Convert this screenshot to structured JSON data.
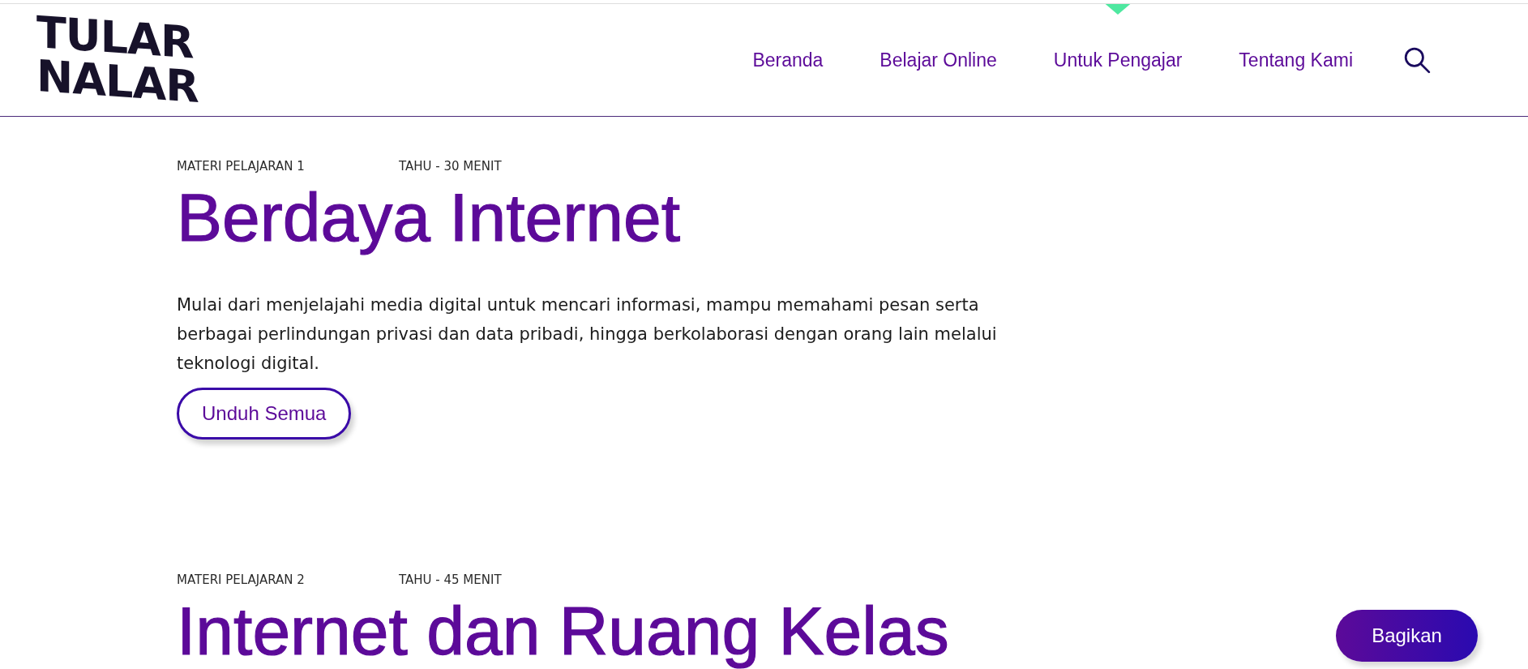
{
  "logo": {
    "lines": [
      "TULAR",
      "NALAR"
    ]
  },
  "nav": {
    "items": [
      {
        "label": "Beranda",
        "selected": false
      },
      {
        "label": "Belajar Online",
        "selected": false
      },
      {
        "label": "Untuk Pengajar",
        "selected": true
      },
      {
        "label": "Tentang Kami",
        "selected": false
      }
    ]
  },
  "lessons": [
    {
      "number": "MATERI PELAJARAN 1",
      "duration": "TAHU - 30 MENIT",
      "title": "Berdaya Internet",
      "description": "Mulai dari menjelajahi media digital untuk mencari informasi, mampu memahami pesan serta berbagai perlindungan privasi dan data pribadi, hingga berkolaborasi dengan orang lain melalui teknologi digital.",
      "button": "Unduh Semua"
    },
    {
      "number": "MATERI PELAJARAN 2",
      "duration": "TAHU - 45 MENIT",
      "title": "Internet dan Ruang Kelas"
    }
  ],
  "share_button": "Bagikan"
}
